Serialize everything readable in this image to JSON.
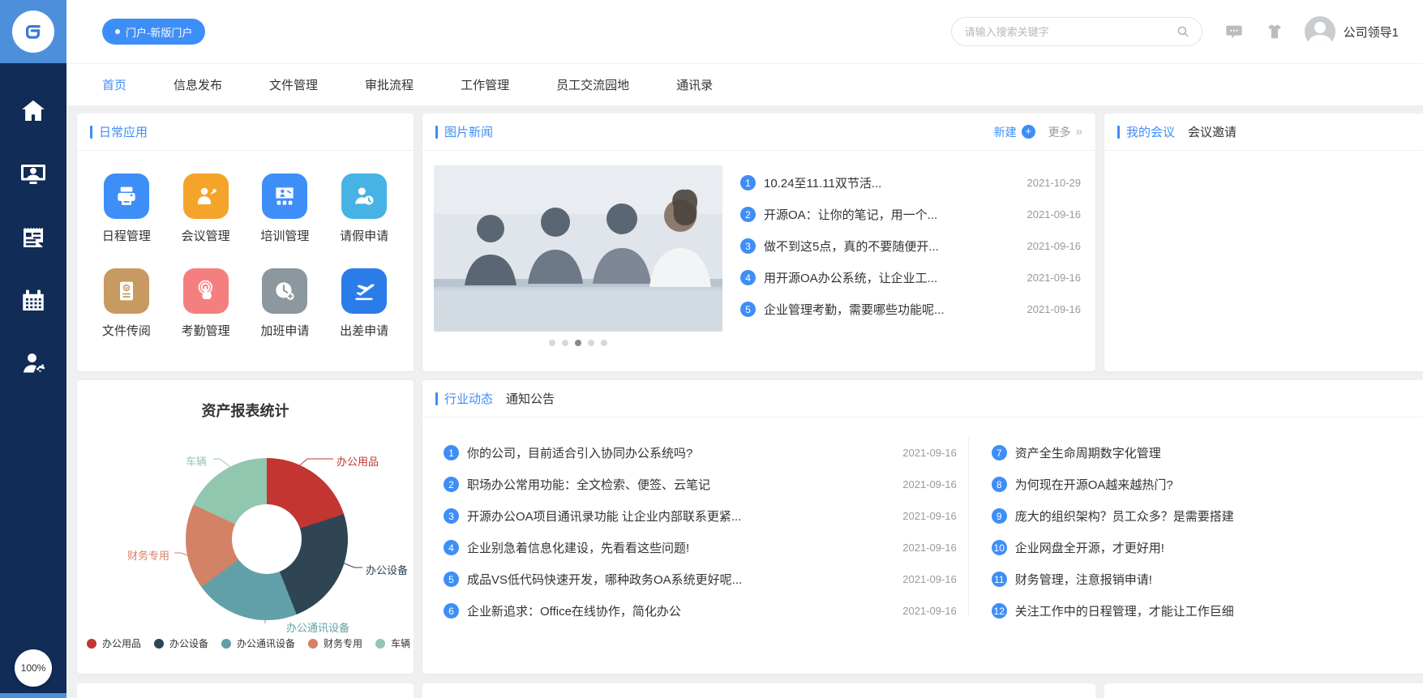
{
  "app": {
    "zoom_level": "100%"
  },
  "header": {
    "portal_tab": "门户-新版门户",
    "search_placeholder": "请输入搜索关键字",
    "user_name": "公司领导1"
  },
  "nav": {
    "tabs": [
      {
        "label": "首页",
        "active": true
      },
      {
        "label": "信息发布",
        "active": false
      },
      {
        "label": "文件管理",
        "active": false
      },
      {
        "label": "审批流程",
        "active": false
      },
      {
        "label": "工作管理",
        "active": false
      },
      {
        "label": "员工交流园地",
        "active": false
      },
      {
        "label": "通讯录",
        "active": false
      }
    ]
  },
  "sidebar": {
    "icons": [
      "home-icon",
      "video-meeting-icon",
      "news-icon",
      "calendar-icon",
      "user-settings-icon"
    ]
  },
  "daily_apps": {
    "title": "日常应用",
    "apps": [
      {
        "label": "日程管理",
        "color": "#3e8ef7",
        "icon": "printer-icon"
      },
      {
        "label": "会议管理",
        "color": "#f5a42a",
        "icon": "meeting-icon"
      },
      {
        "label": "培训管理",
        "color": "#3e8ef7",
        "icon": "training-icon"
      },
      {
        "label": "请假申请",
        "color": "#47b2e4",
        "icon": "leave-icon"
      },
      {
        "label": "文件传阅",
        "color": "#c79a62",
        "icon": "document-icon"
      },
      {
        "label": "考勤管理",
        "color": "#f57f7f",
        "icon": "attendance-icon"
      },
      {
        "label": "加班申请",
        "color": "#8d979e",
        "icon": "overtime-icon"
      },
      {
        "label": "出差申请",
        "color": "#2b7ce9",
        "icon": "trip-icon"
      }
    ]
  },
  "picture_news": {
    "title": "图片新闻",
    "new_label": "新建",
    "more_label": "更多",
    "more_arrows": "»",
    "active_dot": 2,
    "items": [
      {
        "num": "1",
        "text": "10.24至11.11双节活...",
        "date": "2021-10-29"
      },
      {
        "num": "2",
        "text": "开源OA：让你的笔记，用一个...",
        "date": "2021-09-16"
      },
      {
        "num": "3",
        "text": "做不到这5点，真的不要随便开...",
        "date": "2021-09-16"
      },
      {
        "num": "4",
        "text": "用开源OA办公系统，让企业工...",
        "date": "2021-09-16"
      },
      {
        "num": "5",
        "text": "企业管理考勤，需要哪些功能呢...",
        "date": "2021-09-16"
      }
    ]
  },
  "meetings": {
    "tab_active": "我的会议",
    "tab_inactive": "会议邀请"
  },
  "chart_data": {
    "type": "pie",
    "subtype": "donut",
    "title": "资产报表统计",
    "categories": [
      "办公用品",
      "办公设备",
      "办公通讯设备",
      "财务专用",
      "车辆"
    ],
    "values": [
      20,
      24,
      21,
      17,
      18
    ],
    "unit": "percent-estimated",
    "colors": [
      "#c23531",
      "#2f4554",
      "#61a0a8",
      "#d48265",
      "#91c7ae"
    ],
    "legend_position": "bottom",
    "labels_outside": true
  },
  "industry": {
    "tab_active": "行业动态",
    "tab_inactive": "通知公告",
    "left_items": [
      {
        "num": "1",
        "text": "你的公司，目前适合引入协同办公系统吗?",
        "date": "2021-09-16"
      },
      {
        "num": "2",
        "text": "职场办公常用功能：全文检索、便签、云笔记",
        "date": "2021-09-16"
      },
      {
        "num": "3",
        "text": "开源办公OA项目通讯录功能 让企业内部联系更紧...",
        "date": "2021-09-16"
      },
      {
        "num": "4",
        "text": "企业别急着信息化建设，先看看这些问题!",
        "date": "2021-09-16"
      },
      {
        "num": "5",
        "text": "成品VS低代码快速开发，哪种政务OA系统更好呢...",
        "date": "2021-09-16"
      },
      {
        "num": "6",
        "text": "企业新追求：Office在线协作，简化办公",
        "date": "2021-09-16"
      }
    ],
    "right_items": [
      {
        "num": "7",
        "text": "资产全生命周期数字化管理"
      },
      {
        "num": "8",
        "text": "为何现在开源OA越来越热门?"
      },
      {
        "num": "9",
        "text": "庞大的组织架构？员工众多？是需要搭建"
      },
      {
        "num": "10",
        "text": "企业网盘全开源，才更好用!"
      },
      {
        "num": "11",
        "text": "财务管理，注意报销申请!"
      },
      {
        "num": "12",
        "text": "关注工作中的日程管理，才能让工作巨细"
      }
    ]
  }
}
